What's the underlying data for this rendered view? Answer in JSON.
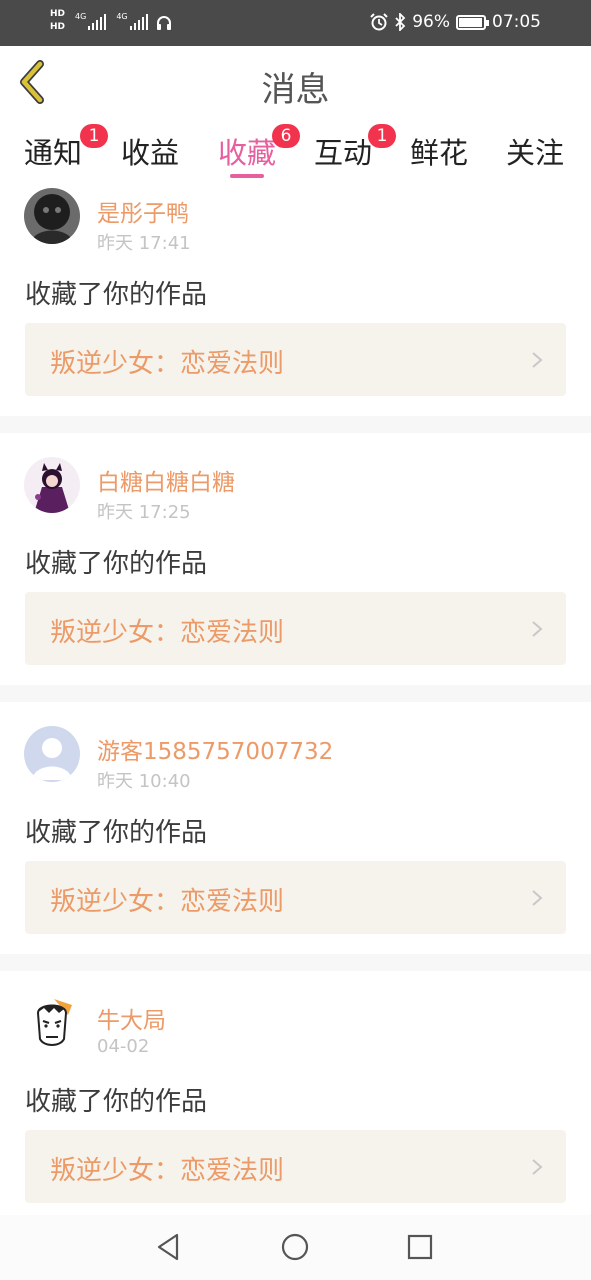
{
  "status_bar": {
    "hd1": "HD",
    "hd2": "HD",
    "net1": "4G",
    "net2": "4G",
    "battery_percent": "96%",
    "battery_level": 0.96,
    "time": "07:05"
  },
  "header": {
    "title": "消息"
  },
  "tabs": [
    {
      "label": "通知",
      "badge": "1"
    },
    {
      "label": "收益",
      "badge": ""
    },
    {
      "label": "收藏",
      "badge": "6",
      "active": true
    },
    {
      "label": "互动",
      "badge": "1"
    },
    {
      "label": "鲜花",
      "badge": ""
    },
    {
      "label": "关注",
      "badge": ""
    }
  ],
  "messages": [
    {
      "user": "是彤子鸭",
      "time": "昨天 17:41",
      "action": "收藏了你的作品",
      "work": "叛逆少女：恋爱法则"
    },
    {
      "user": "白糖白糖白糖",
      "time": "昨天 17:25",
      "action": "收藏了你的作品",
      "work": "叛逆少女：恋爱法则"
    },
    {
      "user": "游客1585757007732",
      "time": "昨天 10:40",
      "action": "收藏了你的作品",
      "work": "叛逆少女：恋爱法则"
    },
    {
      "user": "牛大局",
      "time": "04-02",
      "action": "收藏了你的作品",
      "work": "叛逆少女：恋爱法则"
    }
  ],
  "colors": {
    "accent_pink": "#e6609f",
    "username_orange": "#ec9a67",
    "badge_red": "#f2334d",
    "back_arrow": "#d9c23a"
  },
  "icons": {
    "back": "chevron-left-icon",
    "nav_back": "triangle-back-icon",
    "nav_home": "circle-home-icon",
    "nav_recent": "square-recent-icon"
  }
}
